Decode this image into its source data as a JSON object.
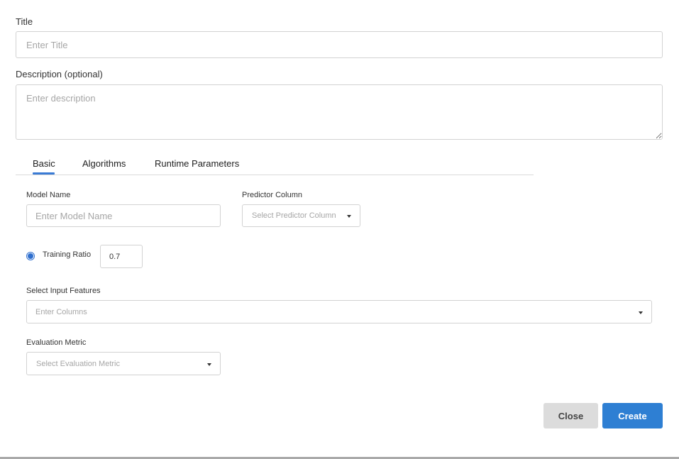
{
  "form": {
    "title_label": "Title",
    "title_placeholder": "Enter Title",
    "description_label": "Description (optional)",
    "description_placeholder": "Enter description"
  },
  "tabs": [
    {
      "label": "Basic",
      "active": true
    },
    {
      "label": "Algorithms",
      "active": false
    },
    {
      "label": "Runtime Parameters",
      "active": false
    }
  ],
  "basic": {
    "model_name_label": "Model Name",
    "model_name_placeholder": "Enter Model Name",
    "predictor_label": "Predictor Column",
    "predictor_placeholder": "Select Predictor Column",
    "training_ratio_label": "Training Ratio",
    "training_ratio_value": "0.7",
    "input_features_label": "Select Input Features",
    "input_features_placeholder": "Enter Columns",
    "evaluation_metric_label": "Evaluation Metric",
    "evaluation_metric_placeholder": "Select Evaluation Metric"
  },
  "buttons": {
    "close": "Close",
    "create": "Create"
  },
  "colors": {
    "accent": "#2e7fd3",
    "tab_underline": "#3a7bd5",
    "secondary_button": "#dcdcdc"
  }
}
